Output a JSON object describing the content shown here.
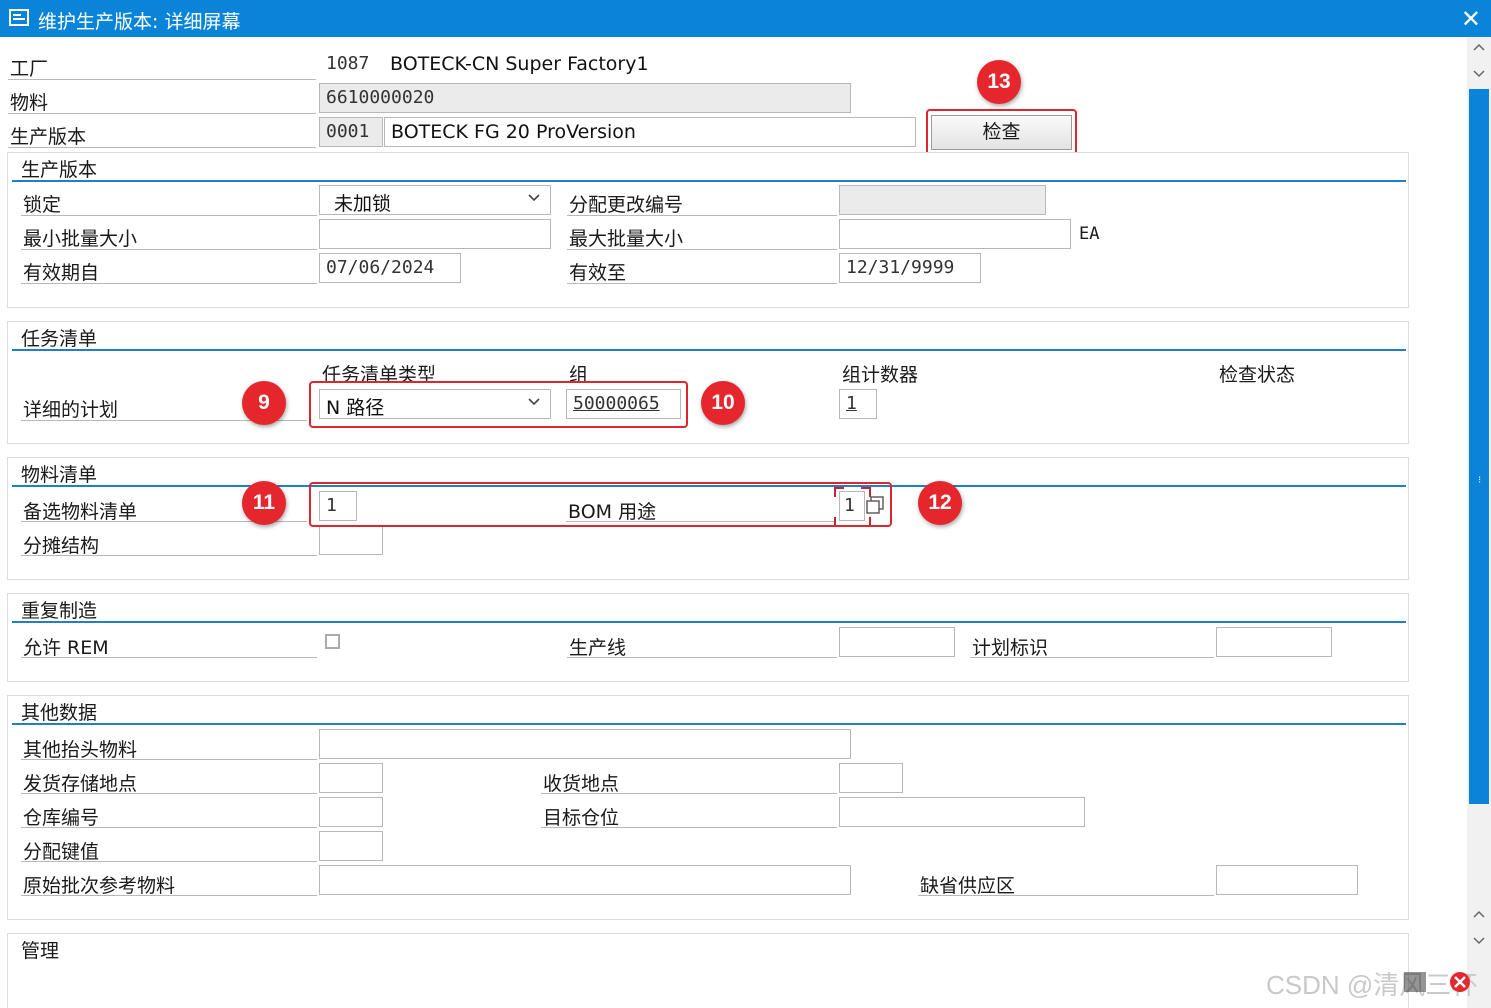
{
  "window": {
    "title": "维护生产版本: 详细屏幕",
    "close_symbol": "✕"
  },
  "header": {
    "plant_label": "工厂",
    "plant_code": "1087",
    "plant_name": "BOTECK-CN Super Factory1",
    "material_label": "物料",
    "material_value": "6610000020",
    "version_label": "生产版本",
    "version_code": "0001",
    "version_text": "BOTECK FG 20 ProVersion",
    "check_button": "检查"
  },
  "section_version": {
    "title": "生产版本",
    "lock_label": "锁定",
    "lock_value": "未加锁",
    "change_no_label": "分配更改编号",
    "change_no_value": "",
    "min_lot_label": "最小批量大小",
    "min_lot_value": "",
    "max_lot_label": "最大批量大小",
    "max_lot_value": "",
    "unit": "EA",
    "valid_from_label": "有效期自",
    "valid_from_value": "07/06/2024",
    "valid_to_label": "有效至",
    "valid_to_value": "12/31/9999"
  },
  "section_tasklist": {
    "title": "任务清单",
    "col_type": "任务清单类型",
    "col_group": "组",
    "col_counter": "组计数器",
    "col_status": "检查状态",
    "row_label": "详细的计划",
    "type_value": "N 路径",
    "group_value": "50000065",
    "counter_value": "1"
  },
  "section_bom": {
    "title": "物料清单",
    "alt_bom_label": "备选物料清单",
    "alt_bom_value": "1",
    "bom_usage_label": "BOM 用途",
    "bom_usage_value": "1",
    "apportion_label": "分摊结构",
    "apportion_value": ""
  },
  "section_rem": {
    "title": "重复制造",
    "allow_rem_label": "允许 REM",
    "prod_line_label": "生产线",
    "prod_line_value": "",
    "plan_id_label": "计划标识",
    "plan_id_value": ""
  },
  "section_other": {
    "title": "其他数据",
    "other_header_label": "其他抬头物料",
    "other_header_value": "",
    "issue_sloc_label": "发货存储地点",
    "issue_sloc_value": "",
    "receipt_point_label": "收货地点",
    "receipt_point_value": "",
    "warehouse_label": "仓库编号",
    "warehouse_value": "",
    "dest_bin_label": "目标仓位",
    "dest_bin_value": "",
    "dist_key_label": "分配键值",
    "dist_key_value": "",
    "orig_batch_label": "原始批次参考物料",
    "orig_batch_value": "",
    "default_supply_label": "缺省供应区",
    "default_supply_value": ""
  },
  "section_admin": {
    "title": "管理"
  },
  "markers": {
    "m9": "9",
    "m10": "10",
    "m11": "11",
    "m12": "12",
    "m13": "13"
  },
  "watermark": "CSDN @清风三杯",
  "colors": {
    "titlebar": "#0a84d8",
    "section_line": "#1f7fcf",
    "annotation_red": "#e0262c"
  }
}
